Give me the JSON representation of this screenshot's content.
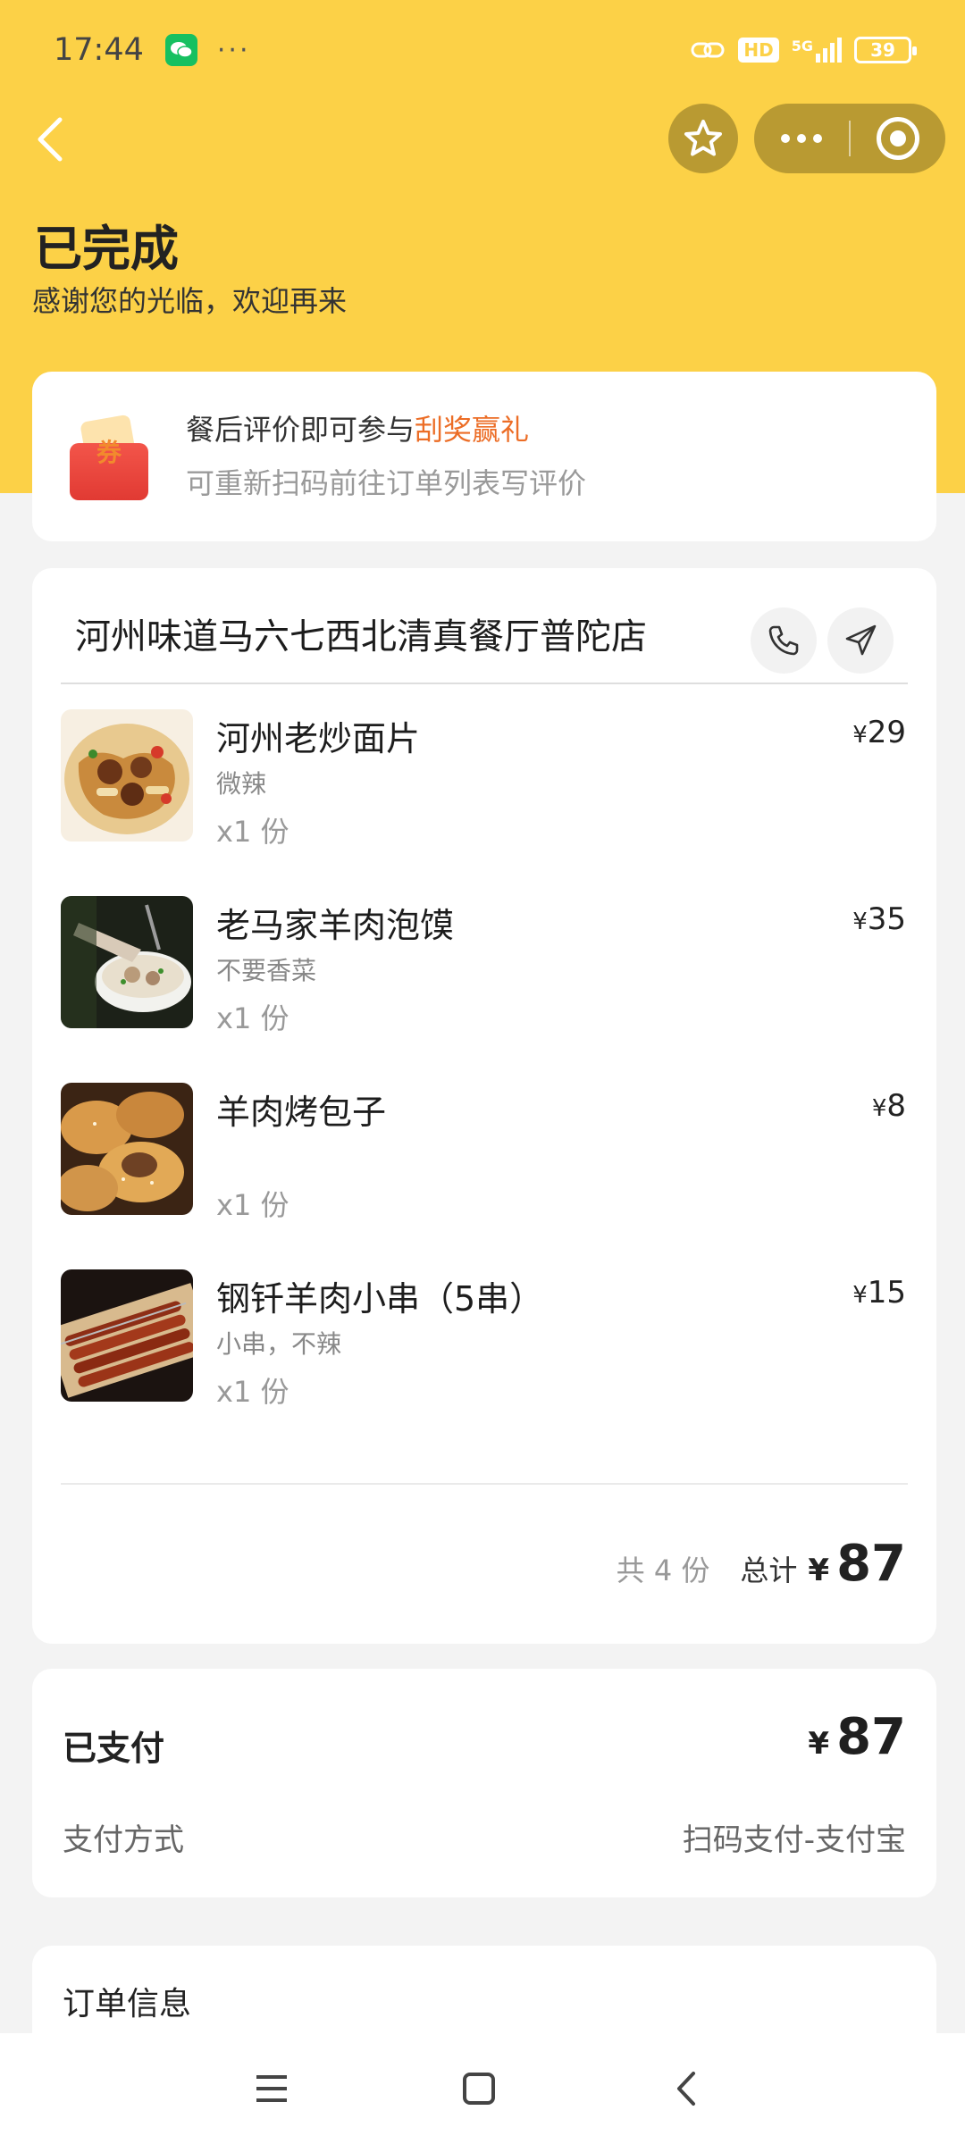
{
  "status_bar": {
    "time": "17:44",
    "dots": "···",
    "hd_label": "HD",
    "network_label": "5G",
    "battery": "39"
  },
  "header": {
    "status_title": "已完成",
    "subtitle": "感谢您的光临，欢迎再来"
  },
  "review_banner": {
    "text_prefix": "餐后评价即可参与",
    "highlight": "刮奖赢礼",
    "subtext": "可重新扫码前往订单列表写评价",
    "coupon_char": "券",
    "highlight_color": "#ec6d26"
  },
  "store": {
    "name": "河州味道马六七西北清真餐厅普陀店"
  },
  "items": [
    {
      "name": "河州老炒面片",
      "spec": "微辣",
      "qty": "x1 份",
      "yen": "¥",
      "price": "29"
    },
    {
      "name": "老马家羊肉泡馍",
      "spec": "不要香菜",
      "qty": "x1 份",
      "yen": "¥",
      "price": "35"
    },
    {
      "name": "羊肉烤包子",
      "spec": "",
      "qty": "x1 份",
      "yen": "¥",
      "price": "8"
    },
    {
      "name": "钢钎羊肉小串（5串）",
      "spec": "小串，不辣",
      "qty": "x1 份",
      "yen": "¥",
      "price": "15"
    }
  ],
  "summary": {
    "count_text": "共 4 份",
    "total_label": "总计",
    "yen": "¥",
    "total": "87"
  },
  "payment": {
    "title": "已支付",
    "yen": "¥",
    "amount": "87",
    "method_label": "支付方式",
    "method_value": "扫码支付-支付宝"
  },
  "order_info": {
    "title": "订单信息"
  },
  "colors": {
    "brand_yellow": "#fcd147",
    "capsule": "#b99a32"
  }
}
